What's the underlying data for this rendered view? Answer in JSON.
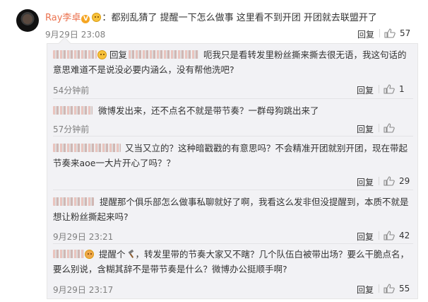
{
  "main_comment": {
    "username": "Ray李卓",
    "badge": "V",
    "text": "都别乱猜了 提醒一下怎么做事  这里看不到开团 开团就去联盟开了",
    "time": "9月29日 23:08",
    "reply_label": "回复",
    "likes": "57"
  },
  "replies": [
    {
      "prefix": "回复",
      "text": "呃我只是看转发里粉丝撕来撕去很无语，我这句话的意思难道不是说没必要内涵么，没有帮他洗吧?",
      "time": "54分钟前",
      "reply_label": "回复",
      "likes": "1"
    },
    {
      "text": "微博发出来，还不点名不就是带节奏？一群母狗跳出来了",
      "time": "57分钟前",
      "reply_label": "回复",
      "likes": ""
    },
    {
      "text": "又当又立的？这种暗戳戳的有意思吗？不会精准开团就别开团，现在带起节奏来aoe一大片开心了吗？？",
      "time": "",
      "reply_label": "回复",
      "likes": "29"
    },
    {
      "text": "提醒那个俱乐部怎么做事私聊就好了啊，我看这么发非但没提醒到，本质不就是想让粉丝撕起来吗?",
      "time": "9月29日 23:21",
      "reply_label": "回复",
      "likes": "42"
    },
    {
      "text_a": "提醒个",
      "text_b": "，转发里带的节奏大家又不瞎？几个队伍白被带出场？要么干脆点名，要么别说，含糊其辞不是带节奏是什么？微博办公挺顺手啊?",
      "time": "9月29日 23:17",
      "reply_label": "回复",
      "likes": "55"
    }
  ],
  "colors": {
    "username": "#eb7350",
    "meta": "#808080",
    "reply_bg": "#f2f2f5"
  },
  "icons": [
    "like-icon",
    "emoji-icon",
    "hammer-icon",
    "verified-badge-icon"
  ]
}
